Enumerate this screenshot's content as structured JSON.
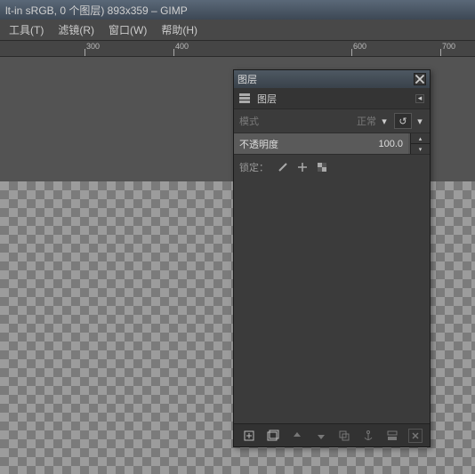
{
  "window": {
    "title": "lt-in sRGB, 0 个图层) 893x359 – GIMP"
  },
  "menu": {
    "tools": "工具(T)",
    "filters": "滤镜(R)",
    "windows": "窗口(W)",
    "help": "帮助(H)"
  },
  "ruler": {
    "ticks": [
      300,
      400,
      600,
      700
    ]
  },
  "layers_panel": {
    "title": "图层",
    "tab_label": "图层",
    "mode": {
      "label": "模式",
      "value": "正常"
    },
    "opacity": {
      "label": "不透明度",
      "value": "100.0"
    },
    "lock": {
      "label": "锁定："
    },
    "footer": {
      "new": "new-layer",
      "group": "new-group",
      "up": "raise",
      "down": "lower",
      "dup": "duplicate",
      "anchor": "anchor",
      "merge": "merge-down",
      "delete": "delete"
    }
  }
}
